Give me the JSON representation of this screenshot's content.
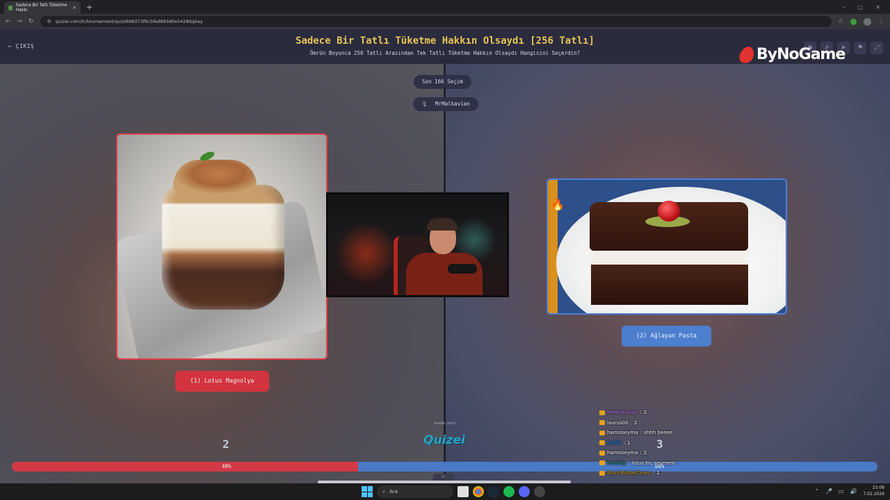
{
  "browser": {
    "tab_title": "Sadece Bir Tatlı Tüketme Hakkı",
    "tab_close": "×",
    "new_tab": "+",
    "url": "quizei.com/tr/tournament/quiz/698373f9c5fed893d0e54280/play",
    "window_controls": [
      "–",
      "▢",
      "✕"
    ]
  },
  "header": {
    "exit_label": "ÇIKIŞ",
    "title": "Sadece Bir Tatlı Tüketme Hakkın Olsaydı [256 Tatlı]",
    "subtitle": "Ömrün Boyunca 256 Tatlı Arasından Tek Tatlı Tüketme Hakkın Olsaydı Hangisini Seçerdin?",
    "icons": [
      "eye-icon",
      "share-icon",
      "send-icon",
      "flag-icon",
      "expand-icon"
    ]
  },
  "overlay": {
    "logo_text": "ByNoGame"
  },
  "match": {
    "round_label": "Son 166 Seçim",
    "streamer_name": "MrMalkavian",
    "left_option": "(1) Lotus Magnolya",
    "right_option": "(2) Ağlayan Pasta",
    "left_score": "2",
    "right_score": "3",
    "left_percent_label": "40%",
    "right_percent_label": "60%",
    "left_fraction": 0.4,
    "accent_left": "#d3343f",
    "accent_right": "#4d7fcf"
  },
  "footer": {
    "made_with": "made with",
    "brand": "Quizei"
  },
  "chat": [
    {
      "user": "MrMalkavian",
      "text": "2",
      "color": "#c77dff"
    },
    {
      "user": "laurus00",
      "text": "2",
      "color": "#ffffff"
    },
    {
      "user": "hamsiseyma",
      "text": "ohhh beeee",
      "color": "#ffffff"
    },
    {
      "user": "Ik0fBr",
      "text": "1",
      "color": "#1e90ff"
    },
    {
      "user": "hamsiseyma",
      "text": "2",
      "color": "#ffffff"
    },
    {
      "user": "Fentildy",
      "text": "lotus hiç sevmem",
      "color": "#2e8b57"
    },
    {
      "user": "BlackMidgetDown",
      "text": "1",
      "color": "#daa520"
    }
  ],
  "taskbar": {
    "search_placeholder": "Ara",
    "time": "23:09",
    "date": "7.02.2026"
  }
}
